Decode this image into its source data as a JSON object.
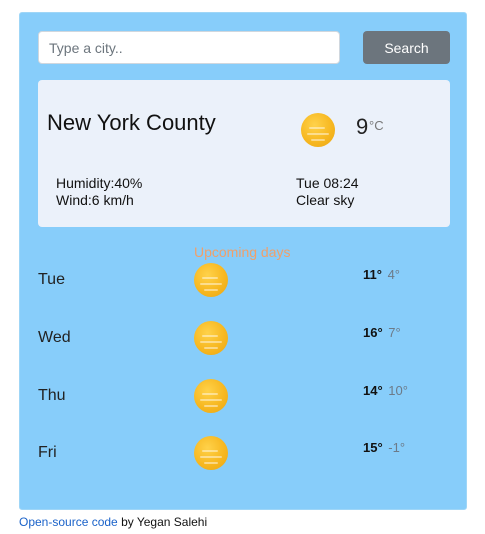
{
  "search": {
    "placeholder": "Type a city..",
    "value": "",
    "button_label": "Search"
  },
  "current": {
    "city": "New York County",
    "icon": "sun-icon",
    "temperature": "9",
    "unit": "°C",
    "humidity": "Humidity:40%",
    "wind": "Wind:6 km/h",
    "datetime": "Tue 08:24",
    "condition": "Clear sky"
  },
  "forecast": {
    "title": "Upcoming days",
    "days": [
      {
        "day": "Tue",
        "icon": "sun-icon",
        "max": "11°",
        "min": "4°"
      },
      {
        "day": "Wed",
        "icon": "sun-icon",
        "max": "16°",
        "min": "7°"
      },
      {
        "day": "Thu",
        "icon": "sun-icon",
        "max": "14°",
        "min": "10°"
      },
      {
        "day": "Fri",
        "icon": "sun-icon",
        "max": "15°",
        "min": "-1°"
      }
    ]
  },
  "footer": {
    "link_text": "Open-source code",
    "suffix": " by Yegan Salehi"
  },
  "colors": {
    "background": "#87cdfa",
    "card": "#ebf1fa",
    "button": "#6c757d",
    "accent_title": "#f0a06a",
    "sun": "#f7b821",
    "link": "#1a62c9"
  }
}
